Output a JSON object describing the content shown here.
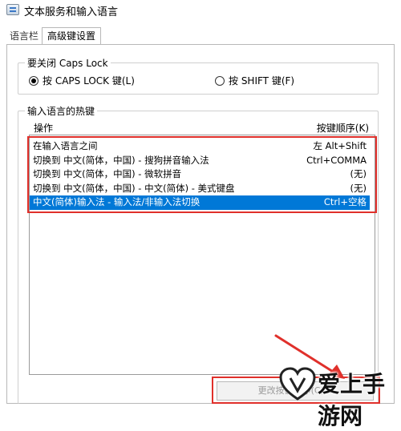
{
  "window": {
    "title": "文本服务和输入语言"
  },
  "tabs": [
    {
      "label": "语言栏"
    },
    {
      "label": "高级键设置"
    }
  ],
  "caps_lock": {
    "title": "要关闭 Caps Lock",
    "options": [
      {
        "label": "按 CAPS LOCK 键(L)",
        "checked": true
      },
      {
        "label": "按 SHIFT 键(F)",
        "checked": false
      }
    ]
  },
  "hotkeys": {
    "title": "输入语言的热键",
    "col_operation": "操作",
    "col_sequence": "按键顺序(K)",
    "rows": [
      {
        "operation": "在输入语言之间",
        "sequence": "左 Alt+Shift"
      },
      {
        "operation": "切换到 中文(简体，中国) - 搜狗拼音输入法",
        "sequence": "Ctrl+COMMA"
      },
      {
        "operation": "切换到 中文(简体，中国) - 微软拼音",
        "sequence": "(无)"
      },
      {
        "operation": "切换到 中文(简体，中国) - 中文(简体) - 美式键盘",
        "sequence": "(无)"
      },
      {
        "operation": "中文(简体)输入法 - 输入法/非输入法切换",
        "sequence": "Ctrl+空格",
        "selected": true
      }
    ]
  },
  "change_button": {
    "label": "更改按键顺序(C)..."
  },
  "watermark": {
    "text": "爱上手游网"
  },
  "colors": {
    "highlight": "#e0302b",
    "selection": "#0078d7"
  }
}
